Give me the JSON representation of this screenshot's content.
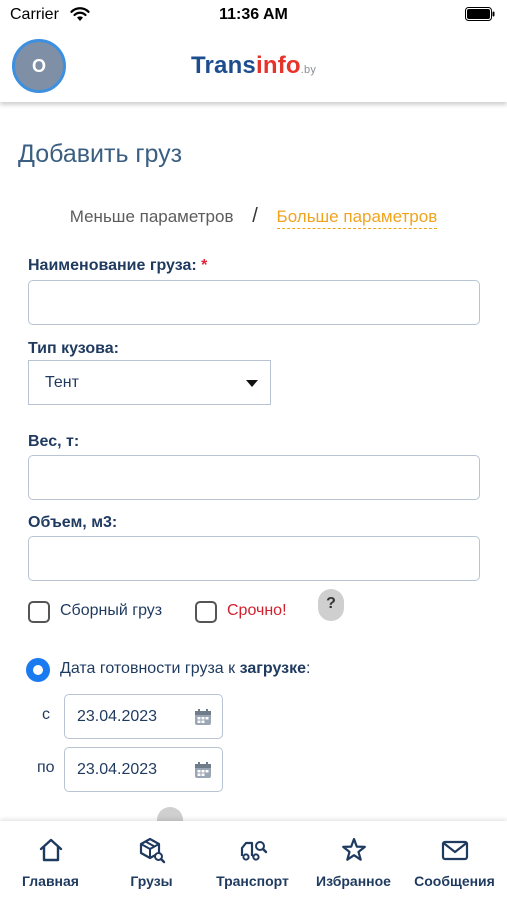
{
  "status_bar": {
    "carrier": "Carrier",
    "time": "11:36 AM"
  },
  "header": {
    "avatar_initial": "O",
    "logo_part1": "Trans",
    "logo_part2": "info",
    "logo_suffix": ".by"
  },
  "page": {
    "title": "Добавить груз",
    "less_params": "Меньше параметров",
    "separator": "/",
    "more_params": "Больше параметров"
  },
  "form": {
    "cargo_name_label": "Наименование груза:",
    "required_mark": "*",
    "cargo_name_value": "",
    "body_type_label": "Тип кузова:",
    "body_type_value": "Тент",
    "weight_label": "Вес, т:",
    "weight_value": "",
    "volume_label": "Объем, м3:",
    "volume_value": "",
    "combined_cargo_label": "Сборный груз",
    "combined_cargo_checked": false,
    "urgent_label": "Срочно!",
    "urgent_checked": false,
    "help_label": "?",
    "date_ready_label_prefix": "Дата готовности груза к ",
    "date_ready_label_bold": "загрузке",
    "date_ready_label_suffix": ":",
    "date_from_prefix": "с",
    "date_from_value": "23.04.2023",
    "date_to_prefix": "по",
    "date_to_value": "23.04.2023"
  },
  "tabbar": {
    "items": [
      {
        "label": "Главная",
        "icon": "home-icon"
      },
      {
        "label": "Грузы",
        "icon": "cargo-search-icon"
      },
      {
        "label": "Транспорт",
        "icon": "truck-search-icon"
      },
      {
        "label": "Избранное",
        "icon": "star-icon"
      },
      {
        "label": "Сообщения",
        "icon": "envelope-icon"
      }
    ]
  },
  "colors": {
    "primary_text": "#1f3a5f",
    "accent_orange": "#f0a41e",
    "required_red": "#e0253a",
    "radio_blue": "#1a7af0"
  }
}
